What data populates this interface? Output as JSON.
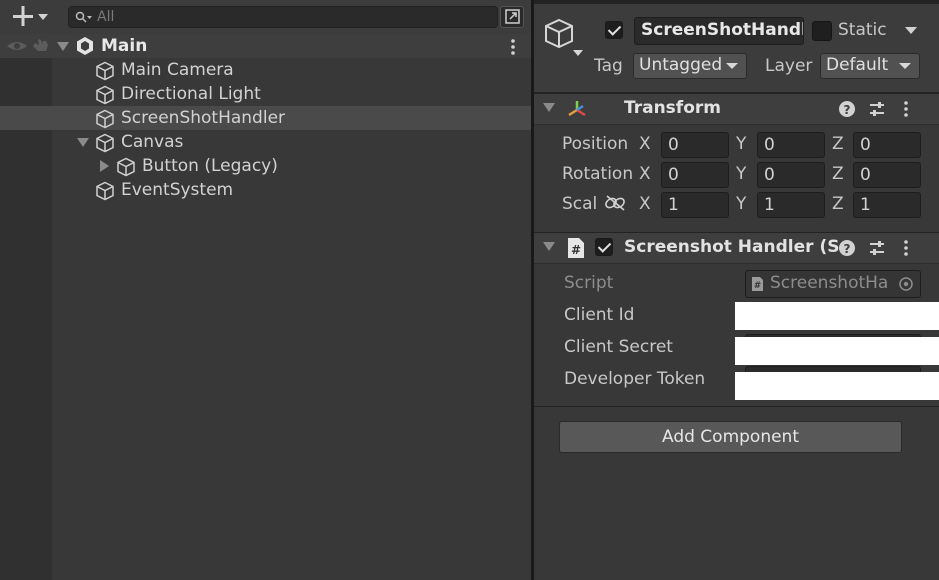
{
  "hierarchy": {
    "search_placeholder": "All",
    "scene": {
      "name": "Main"
    },
    "items": [
      {
        "label": "Main Camera"
      },
      {
        "label": "Directional Light"
      },
      {
        "label": "ScreenShotHandler"
      },
      {
        "label": "Canvas"
      },
      {
        "label": "Button (Legacy)"
      },
      {
        "label": "EventSystem"
      }
    ]
  },
  "inspector": {
    "object_name": "ScreenShotHandle",
    "static_label": "Static",
    "tag_label": "Tag",
    "tag_value": "Untagged",
    "layer_label": "Layer",
    "layer_value": "Default",
    "transform": {
      "title": "Transform",
      "rows": [
        {
          "label": "Position",
          "x": "0",
          "y": "0",
          "z": "0"
        },
        {
          "label": "Rotation",
          "x": "0",
          "y": "0",
          "z": "0"
        },
        {
          "label": "Scal",
          "x": "1",
          "y": "1",
          "z": "1"
        }
      ],
      "axis": {
        "x": "X",
        "y": "Y",
        "z": "Z"
      }
    },
    "script_component": {
      "title": "Screenshot Handler (Sc",
      "script_label": "Script",
      "script_value": "ScreenshotHa",
      "fields": [
        {
          "label": "Client Id",
          "value": ""
        },
        {
          "label": "Client Secret",
          "value": ""
        },
        {
          "label": "Developer Token",
          "value": ""
        }
      ]
    },
    "add_component_label": "Add Component"
  }
}
